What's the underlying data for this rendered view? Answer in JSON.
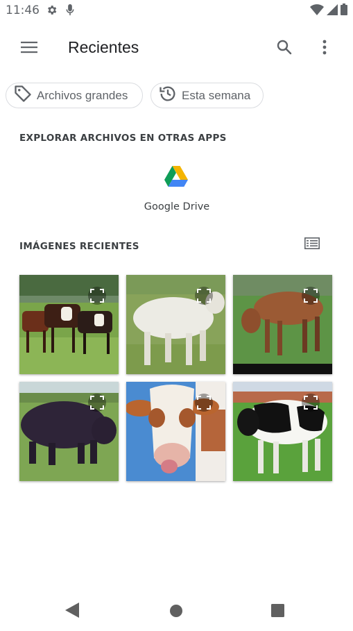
{
  "status_bar": {
    "time": "11:46",
    "icons": [
      "gear-icon",
      "mic-icon",
      "wifi-icon",
      "signal-icon",
      "battery-icon"
    ]
  },
  "app_bar": {
    "title": "Recientes",
    "icons": [
      "menu-icon",
      "search-icon",
      "more-vert-icon"
    ]
  },
  "chips": [
    {
      "label": "Archivos grandes",
      "icon": "tag-icon"
    },
    {
      "label": "Esta semana",
      "icon": "history-icon"
    }
  ],
  "sections": {
    "explore": "EXPLORAR ARCHIVOS EN OTRAS APPS",
    "recent_images": "IMÁGENES RECIENTES"
  },
  "apps": [
    {
      "label": "Google Drive",
      "icon": "google-drive-icon"
    }
  ],
  "images": [
    {
      "subject": "cows-herd"
    },
    {
      "subject": "white-cow"
    },
    {
      "subject": "brown-cow-grazing"
    },
    {
      "subject": "black-bull"
    },
    {
      "subject": "cow-face"
    },
    {
      "subject": "holstein-cow"
    }
  ],
  "colors": {
    "accent": "#5f6368",
    "drive_green": "#0f9d58",
    "drive_yellow": "#f4b400",
    "drive_blue": "#4285f4"
  }
}
